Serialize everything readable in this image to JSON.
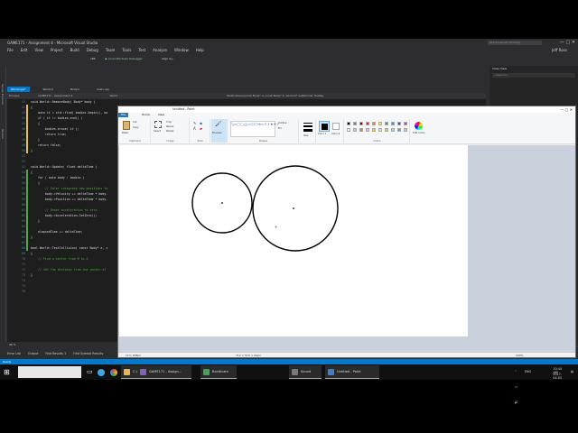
{
  "vs": {
    "title": "GAME171 - Assignment 4 - Microsoft Visual Studio",
    "quick_launch": "Quick Launch (Ctrl+Q)",
    "menu": [
      "File",
      "Edit",
      "View",
      "Project",
      "Build",
      "Debug",
      "Team",
      "Tools",
      "Test",
      "Analyze",
      "Window",
      "Help"
    ],
    "user": "Jeff Ross",
    "toolbar": {
      "config": "x86",
      "run_label": "Local Windows Debugger",
      "align_label": "Align by..."
    },
    "left_strip": [
      "Server Explorer",
      "Toolbox"
    ],
    "tabs": [
      "World.cpp*",
      "World.h",
      "Body.h",
      "main.cpp"
    ],
    "nav": [
      "Process",
      "GAME171 - Assignment 4",
      "World",
      "TestCollision(const Body* a, const Body* b, Vector2* outNormal, float&)"
    ],
    "line_numbers": [
      "41",
      "42",
      "43",
      "44",
      "45",
      "46",
      "47",
      "48",
      "49",
      "50",
      "51",
      "52",
      "53",
      "54",
      "55",
      "56",
      "57",
      "58",
      "59",
      "60",
      "61",
      "62",
      "63",
      "64",
      "65",
      "66",
      "67",
      "68",
      "69",
      "70",
      "71",
      "72",
      "73",
      "74",
      "75",
      "76"
    ],
    "code_lines": [
      "void World::RemoveBody( Body* body )",
      "{",
      "    auto it = std::find( bodies.begin(), bo",
      "    if ( it != bodies.end() )",
      "    {",
      "        bodies.erase( it );",
      "        return true;",
      "    }",
      "    return false;",
      "}",
      "",
      "",
      "void World::Update( float deltaTime )",
      "{",
      "    for ( auto body : bodies )",
      "    {",
      "        // Euler integrate new positions fo",
      "        body->Velocity += deltaTime * body-",
      "        body->Position += deltaTime * body-",
      "",
      "        // Reset acceleration to zero",
      "        body->Acceleration.SetZero();",
      "    }",
      "",
      "    elapsedTime += deltaTime;",
      "}",
      "",
      "bool World::TestCollision( const Body* a, c",
      "{",
      "    // Find a vector from B to A",
      "",
      "    // Get the distance from the center of",
      "}",
      "",
      "",
      ""
    ],
    "right_panel_title": "Class View",
    "right_panel_search": "<Search>",
    "zoom": "96 %",
    "bottom_tabs": [
      "Error List",
      "Output",
      "Find Results 1",
      "Find Symbol Results"
    ],
    "status": "Ready"
  },
  "paint": {
    "title": "Untitled - Paint",
    "menu": {
      "file": "File",
      "items": [
        "Home",
        "View"
      ]
    },
    "groups": {
      "clipboard": {
        "label": "Clipboard",
        "paste": "Paste",
        "cut": "Cut",
        "copy": "Copy"
      },
      "image": {
        "label": "Image",
        "select": "Select",
        "crop": "Crop",
        "resize": "Resize",
        "rotate": "Rotate"
      },
      "tools": {
        "label": "Tools"
      },
      "brushes": "Brushes",
      "shapes": {
        "label": "Shapes",
        "outline": "Outline",
        "fill": "Fill"
      },
      "size": "Size",
      "color1": "Color 1",
      "color2": "Color 2",
      "colors_label": "Colors",
      "edit_colors": "Edit colors"
    },
    "palette": [
      "#000000",
      "#7f7f7f",
      "#880015",
      "#ed1c24",
      "#ff7f27",
      "#fff200",
      "#22b14c",
      "#00a2e8",
      "#3f48cc",
      "#a349a4",
      "#ffffff",
      "#c3c3c3",
      "#b97a57",
      "#ffaec9",
      "#ffc90e",
      "#efe4b0",
      "#b5e61d",
      "#99d9ea",
      "#7092be",
      "#c8bfe7"
    ],
    "status": {
      "cursor": "113, 208px",
      "selection": "",
      "size": "712 × 515 × 64px",
      "zoom": "100%"
    }
  },
  "taskbar": {
    "apps": [
      {
        "label": "C:\\Users\\jross\\Des...",
        "color": "#e8b84a"
      },
      {
        "label": "GAME171 - Assign...",
        "color": "#865fc5"
      },
      {
        "label": "Bandicam",
        "color": "#3aa757"
      },
      {
        "label": "Sound",
        "color": "#7a7a7a"
      },
      {
        "label": "Untitled - Paint",
        "color": "#3b7fd1"
      }
    ],
    "lang": "ENG",
    "time": "10:44 AM",
    "date": "2017-04-03"
  }
}
